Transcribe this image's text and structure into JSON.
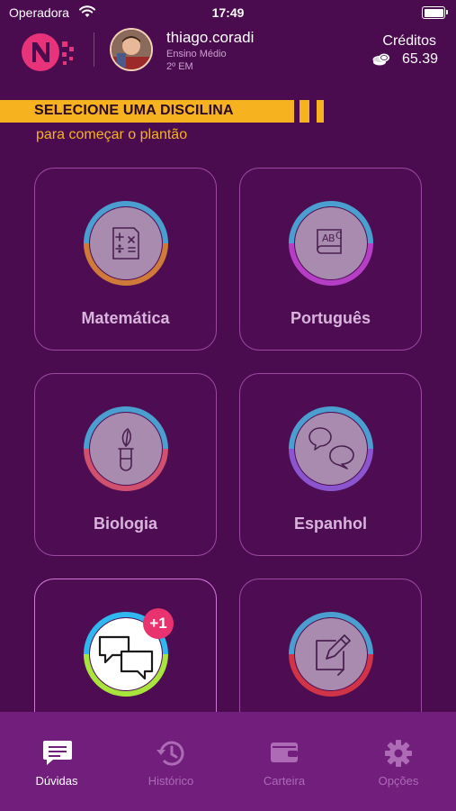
{
  "status_bar": {
    "carrier": "Operadora",
    "time": "17:49"
  },
  "header": {
    "username": "thiago.coradi",
    "level": "Ensino Médio",
    "grade": "2º EM",
    "credits_label": "Créditos",
    "credits_value": "65.39"
  },
  "banner": {
    "title": "SELECIONE UMA DISCILINA",
    "subtitle": "para começar o plantão"
  },
  "subjects": [
    {
      "label": "Matemática",
      "icon": "math-icon",
      "ring_colors": [
        "#4a9fd0",
        "#d07a3a"
      ]
    },
    {
      "label": "Português",
      "icon": "book-abc-icon",
      "ring_colors": [
        "#4a9fd0",
        "#b63ec6"
      ]
    },
    {
      "label": "Biologia",
      "icon": "test-tube-leaf-icon",
      "ring_colors": [
        "#4a9fd0",
        "#d0506e"
      ]
    },
    {
      "label": "Espanhol",
      "icon": "chat-bubbles-icon",
      "ring_colors": [
        "#4a9fd0",
        "#8b55d0"
      ]
    },
    {
      "label": "",
      "icon": "chat-bubbles-icon",
      "ring_colors": [
        "#2fb8f0",
        "#a8e43c"
      ],
      "badge": "+1"
    },
    {
      "label": "",
      "icon": "edit-document-icon",
      "ring_colors": [
        "#4a9fd0",
        "#d03446"
      ]
    }
  ],
  "tabbar": {
    "tabs": [
      {
        "label": "Dúvidas",
        "icon": "chat-icon",
        "active": true
      },
      {
        "label": "Histórico",
        "icon": "history-icon",
        "active": false
      },
      {
        "label": "Carteira",
        "icon": "wallet-icon",
        "active": false
      },
      {
        "label": "Opções",
        "icon": "gear-icon",
        "active": false
      }
    ]
  },
  "colors": {
    "background": "#4a0b4f",
    "accent": "#f6b21f",
    "tabbar": "#721e7d",
    "logo": "#e8337a",
    "badge": "#e8336e"
  }
}
